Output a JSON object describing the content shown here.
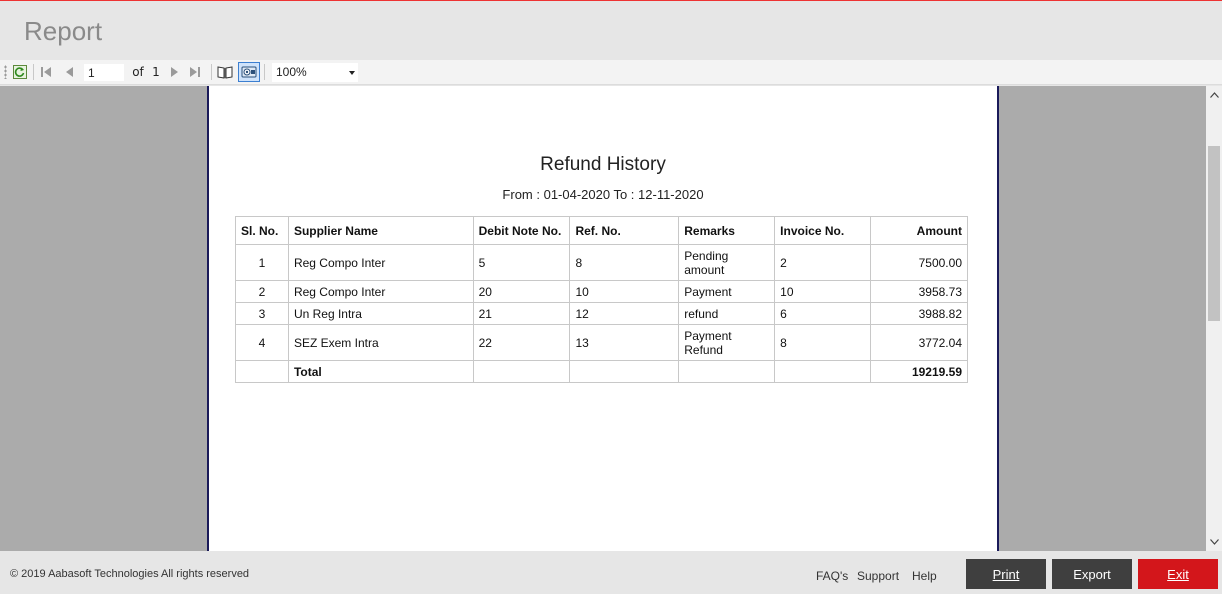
{
  "window": {
    "title": "Report"
  },
  "toolbar": {
    "current_page": "1",
    "of_label": "of",
    "total_pages": "1",
    "zoom": "100%",
    "icons": [
      "refresh-icon",
      "first-page-icon",
      "previous-page-icon",
      "next-page-icon",
      "last-page-icon",
      "print-layout-icon",
      "page-setup-icon"
    ]
  },
  "report": {
    "title": "Refund History",
    "date_range": "From : 01-04-2020 To : 12-11-2020",
    "columns": [
      "Sl. No.",
      "Supplier Name",
      "Debit Note No.",
      "Ref. No.",
      "Remarks",
      "Invoice No.",
      "Amount"
    ],
    "rows": [
      {
        "sl": "1",
        "supplier": "Reg Compo Inter",
        "debit_note": "5",
        "ref": "8",
        "remarks_1": "Pending",
        "remarks_2": "amount",
        "invoice": "2",
        "amount": "7500.00"
      },
      {
        "sl": "2",
        "supplier": "Reg Compo Inter",
        "debit_note": "20",
        "ref": "10",
        "remarks_1": "Payment",
        "remarks_2": "",
        "invoice": "10",
        "amount": "3958.73"
      },
      {
        "sl": "3",
        "supplier": "Un Reg Intra",
        "debit_note": "21",
        "ref": "12",
        "remarks_1": "refund",
        "remarks_2": "",
        "invoice": "6",
        "amount": "3988.82"
      },
      {
        "sl": "4",
        "supplier": "SEZ Exem Intra",
        "debit_note": "22",
        "ref": "13",
        "remarks_1": "Payment",
        "remarks_2": "Refund",
        "invoice": "8",
        "amount": "3772.04"
      }
    ],
    "total_label": "Total",
    "total_amount": "19219.59"
  },
  "footer": {
    "copyright": "© 2019 Aabasoft Technologies All rights reserved",
    "links": {
      "faqs": "FAQ's",
      "support": "Support",
      "help": "Help"
    },
    "buttons": {
      "print": "Print",
      "export": "Export",
      "exit": "Exit"
    }
  },
  "colors": {
    "accent_red": "#d3161b",
    "button_dark": "#3f3f3f",
    "viewer_bg": "#ababab"
  }
}
